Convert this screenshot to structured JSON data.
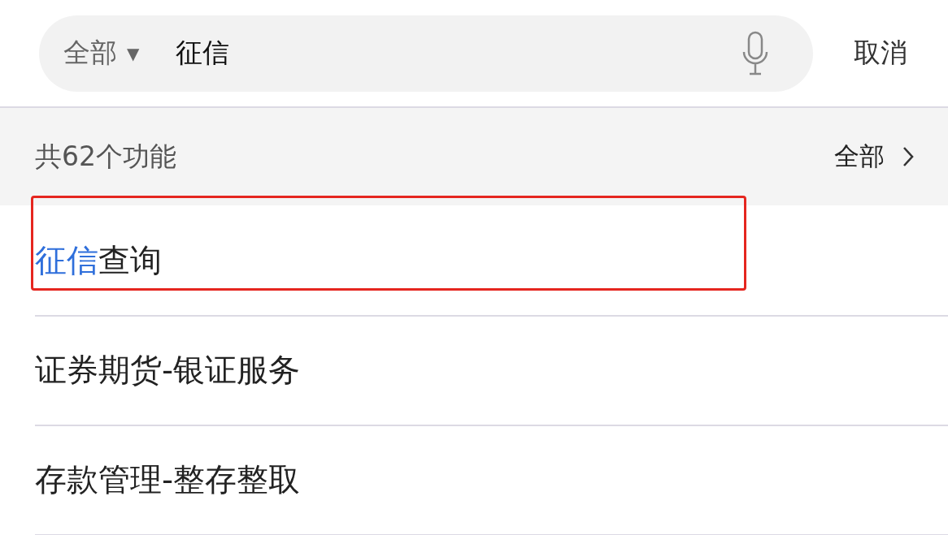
{
  "search": {
    "scope": "全部",
    "scope_caret": "▼",
    "query": "征信",
    "cancel": "取消"
  },
  "summary": {
    "count_text": "共62个功能",
    "all_link": "全部"
  },
  "results": [
    {
      "match": "征信",
      "rest": "查询",
      "highlighted": true
    },
    {
      "rest": "证券期货-银证服务",
      "highlighted": false
    },
    {
      "rest": "存款管理-整存整取",
      "highlighted": false
    }
  ]
}
